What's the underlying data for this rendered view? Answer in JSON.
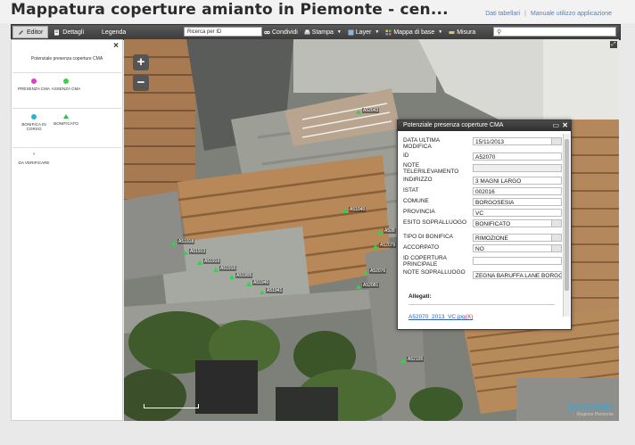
{
  "header": {
    "title": "Mappatura coperture amianto in Piemonte - cen...",
    "links": [
      "Dati tabellari",
      "Manuale utilizzo applicazione"
    ]
  },
  "toolbar": {
    "tabs": [
      "Editor",
      "Dettagli",
      "Legenda"
    ],
    "search_value": "Ricerca per ID",
    "menus": [
      "Condividi",
      "Stampa",
      "Layer",
      "Mappa di base",
      "Misura"
    ]
  },
  "legend": {
    "title": "Potenziale presenza coperture CMA",
    "items": [
      {
        "label": "PRESENZA CMA",
        "color": "#e23cc8",
        "shape": "dot"
      },
      {
        "label": "ASSENZA CMA",
        "color": "#3ccf46",
        "shape": "dot"
      },
      {
        "label": "BONIFICA IN CORSO",
        "color": "#2bb0d8",
        "shape": "dot"
      },
      {
        "label": "BONIFICATO",
        "color": "#2ec24a",
        "shape": "triangle"
      },
      {
        "label": "DA VERIFICARE",
        "color": "#e05050",
        "shape": "star"
      }
    ]
  },
  "map": {
    "markers": [
      "A52043",
      "A51040",
      "A51918",
      "A51913",
      "A51919",
      "A51916",
      "A51905",
      "A51940",
      "A51941",
      "A52079",
      "A52076",
      "A52081",
      "A52105",
      "A528"
    ],
    "brand": "geoportale",
    "brand_sub": "Regione Piemonte"
  },
  "popup": {
    "title": "Potenziale presenza coperture CMA",
    "fields": [
      {
        "label": "DATA ULTIMA MODIFICA",
        "value": "15/11/2013",
        "select": true
      },
      {
        "label": "ID",
        "value": "A52070"
      },
      {
        "label": "NOTE TELERILEVAMENTO",
        "value": "",
        "disabled": true
      },
      {
        "label": "INDIRIZZO",
        "value": "3 MAGNI LARGO"
      },
      {
        "label": "ISTAT",
        "value": "002016"
      },
      {
        "label": "COMUNE",
        "value": "BORGOSESIA"
      },
      {
        "label": "PROVINCIA",
        "value": "VC"
      },
      {
        "label": "ESITO SOPRALLUOGO",
        "value": "BONIFICATO",
        "select": true
      },
      {
        "label": "TIPO DI BONIFICA",
        "value": "RIMOZIONE",
        "select": true
      },
      {
        "label": "ACCORPATO",
        "value": "NO",
        "select": true
      },
      {
        "label": "ID COPERTURA PRINCIPALE",
        "value": ""
      },
      {
        "label": "NOTE SOPRALLUOGO",
        "value": "ZEGNA BARUFFA LANE BORGO"
      }
    ],
    "attachments_label": "Allegati:",
    "attachment_file": "A52070_2013_VC.jpg",
    "attachment_remove": "(X)"
  },
  "colors": {
    "toolbar": "#444444",
    "marker": "#35d04e",
    "link": "#2f5fb0"
  }
}
